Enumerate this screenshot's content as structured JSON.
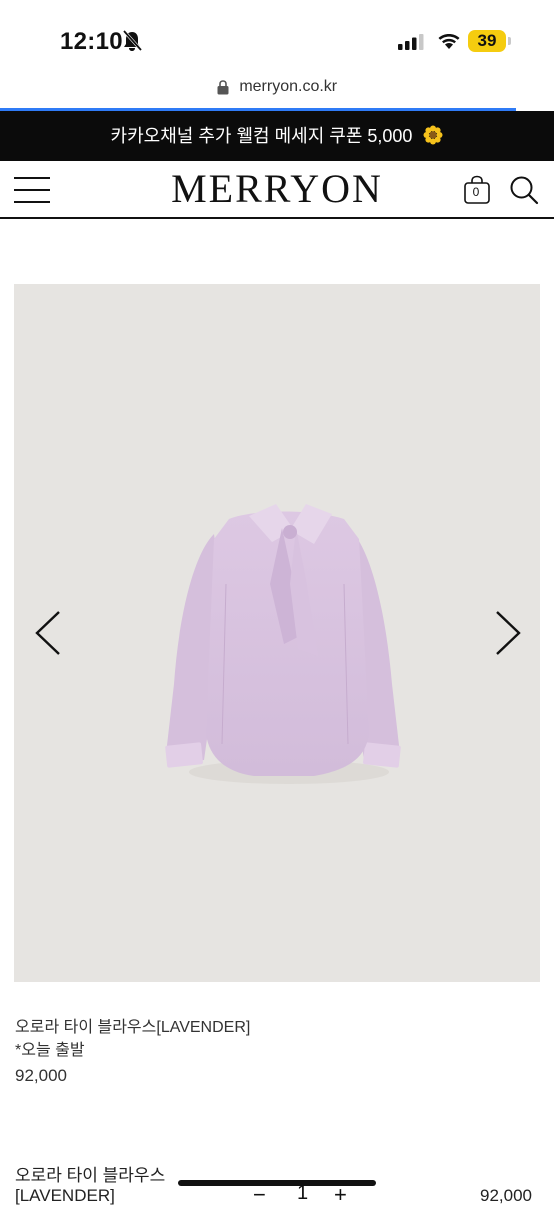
{
  "status_bar": {
    "time": "12:10",
    "battery": "39",
    "icons": [
      "bell-slash-icon",
      "signal-icon",
      "wifi-icon",
      "battery-icon"
    ]
  },
  "browser": {
    "url": "merryon.co.kr"
  },
  "promo": {
    "text": "카카오채널 추가 웰컴 메세지 쿠폰 5,000",
    "icon": "flower-icon"
  },
  "header": {
    "logo": "MERRYON",
    "cart_count": "0"
  },
  "product": {
    "name": "오로라 타이 블라우스[LAVENDER]",
    "note": "*오늘 출발",
    "price": "92,000",
    "image_bg": "#e6e4e1",
    "blouse_color": "#d9c3e0"
  },
  "option_row": {
    "name": "오로라 타이 블라우스[LAVENDER]",
    "minus": "−",
    "quantity": "1",
    "plus": "+",
    "price": "92,000"
  }
}
